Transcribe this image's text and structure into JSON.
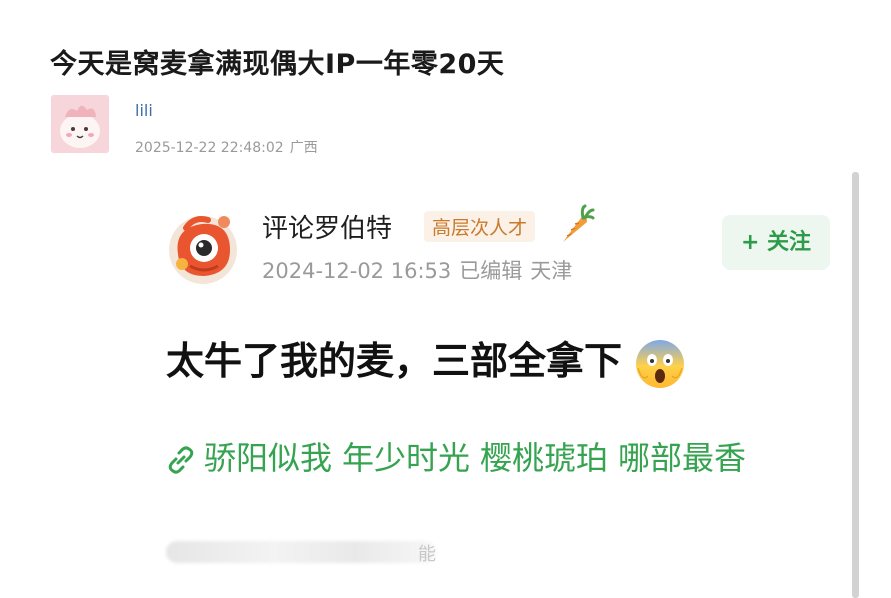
{
  "post": {
    "title": "今天是窝麦拿满现偶大IP一年零20天",
    "author": "lili",
    "datetime": "2025-12-22 22:48:02",
    "location": "广西"
  },
  "comment": {
    "username": "评论罗伯特",
    "badge": "高层次人才",
    "datetime": "2024-12-02 16:53",
    "edited": "已编辑",
    "location": "天津",
    "follow_label": "+ 关注",
    "body": "太牛了我的麦，三部全拿下",
    "tags": [
      "骄阳似我",
      "年少时光",
      "樱桃琥珀",
      "哪部最香"
    ],
    "blurred_tail": "能"
  },
  "colors": {
    "accent_green": "#35a34f",
    "badge_orange": "#c97a2e",
    "author_blue": "#3b6fa8"
  },
  "icons": {
    "avatar": "cartoon-pink-avatar",
    "commenter_avatar": "orange-mascot-avatar",
    "badge_icon": "carrot-icon",
    "emoji": "screaming-face-emoji",
    "tag_icon": "link-icon"
  }
}
